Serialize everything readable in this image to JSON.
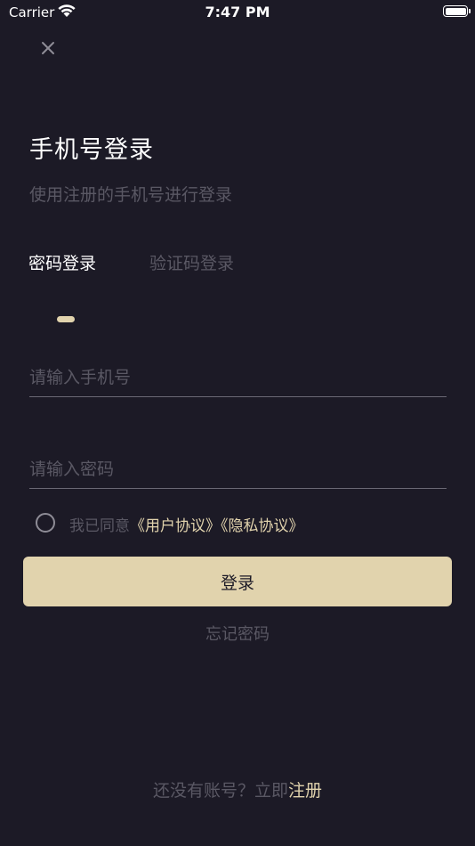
{
  "status_bar": {
    "carrier": "Carrier",
    "time": "7:47 PM",
    "icons": [
      "wifi-icon",
      "battery-icon"
    ]
  },
  "header": {
    "close_icon": "close-icon",
    "title": "手机号登录",
    "subtitle": "使用注册的手机号进行登录"
  },
  "tabs": [
    {
      "label": "密码登录",
      "active": true
    },
    {
      "label": "验证码登录",
      "active": false
    }
  ],
  "form": {
    "phone_placeholder": "请输入手机号",
    "phone_value": "",
    "password_placeholder": "请输入密码",
    "password_value": ""
  },
  "agreement": {
    "checked": false,
    "prefix": "我已同意",
    "user_agreement": "《用户协议》",
    "privacy_policy": "《隐私协议》"
  },
  "actions": {
    "login_label": "登录",
    "forgot_label": "忘记密码"
  },
  "footer": {
    "prompt": "还没有账号？立即",
    "register_label": "注册"
  },
  "colors": {
    "background": "#1c1a26",
    "accent": "#e1d3ad",
    "muted_text": "#5a5864",
    "primary_text": "#ffffff"
  }
}
